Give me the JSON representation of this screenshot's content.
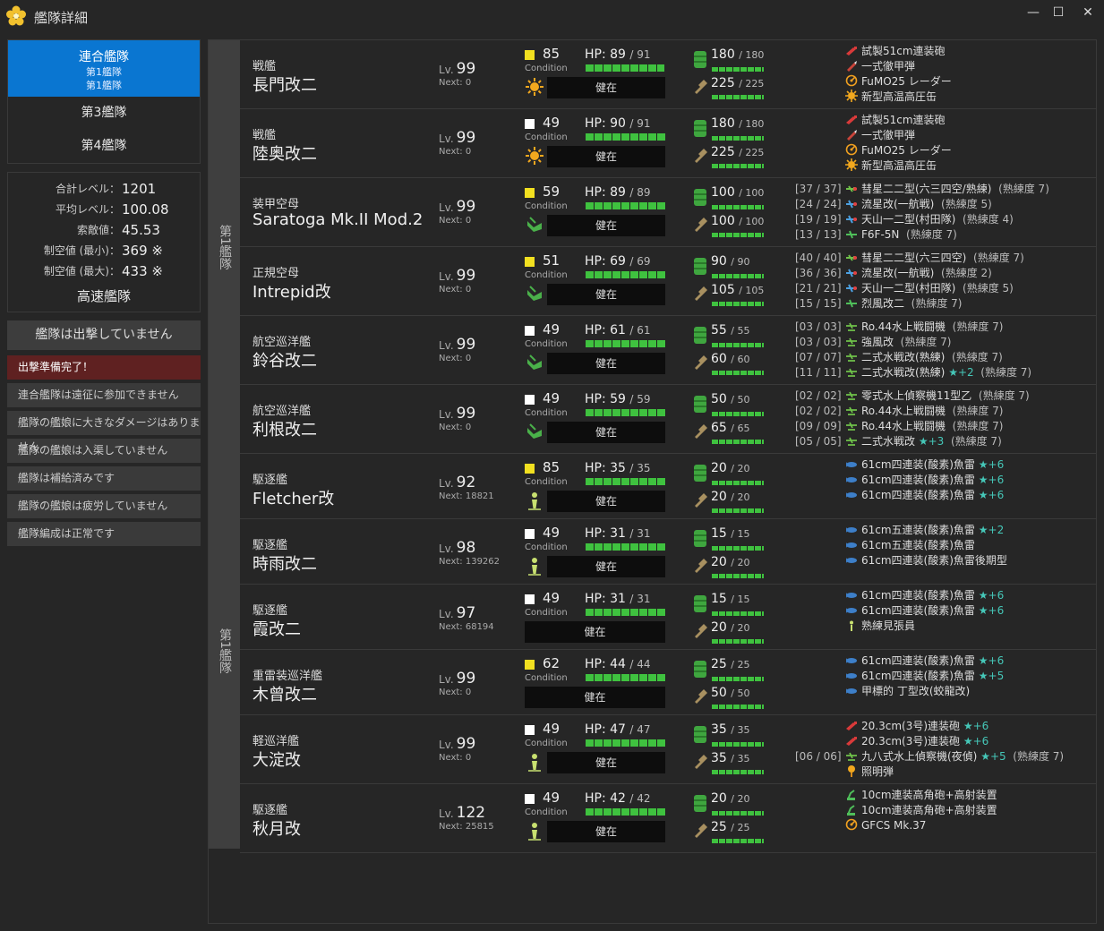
{
  "window": {
    "title": "艦隊詳細",
    "min": "—",
    "max": "☐",
    "close": "✕",
    "accent": "#0a76d1"
  },
  "sidebar": {
    "fleets": [
      {
        "label": "連合艦隊",
        "sub1": "第1艦隊",
        "sub2": "第1艦隊"
      },
      {
        "label": "第3艦隊"
      },
      {
        "label": "第4艦隊"
      }
    ],
    "stats": [
      {
        "label": "合計レベル：",
        "value": "1201"
      },
      {
        "label": "平均レベル：",
        "value": "100.08"
      },
      {
        "label": "索敵値：",
        "value": "45.53"
      },
      {
        "label": "制空値 (最小)：",
        "value": "369 ※"
      },
      {
        "label": "制空値 (最大)：",
        "value": "433 ※"
      }
    ],
    "speed": "高速艦隊",
    "sortie": "艦隊は出撃していません",
    "ready": "出撃準備完了！",
    "checks": [
      "連合艦隊は遠征に参加できません",
      "艦隊の艦娘に大きなダメージはありません",
      "艦隊の艦娘は入渠していません",
      "艦隊は補給済みです",
      "艦隊の艦娘は疲労していません",
      "艦隊編成は正常です"
    ]
  },
  "groups": [
    "第1艦隊",
    "第1艦隊"
  ],
  "ships": [
    {
      "type": "戦艦",
      "name": "長門改二",
      "lv": "99",
      "next": "Next: 0",
      "cond": "85",
      "condColor": "#f2e020",
      "condIcon": "sun",
      "hp": "89",
      "maxhp": "91",
      "hpFrac": 0.98,
      "status": "健在",
      "fuel": "180",
      "maxfuel": "180",
      "ammo": "225",
      "maxammo": "225",
      "eq": [
        {
          "slot": "",
          "name": "試製51cm連装砲",
          "icon": "gun-red"
        },
        {
          "slot": "",
          "name": "一式徹甲弾",
          "icon": "shell"
        },
        {
          "slot": "",
          "name": "FuMO25 レーダー",
          "icon": "radar"
        },
        {
          "slot": "",
          "name": "新型高温高圧缶",
          "icon": "boiler"
        }
      ]
    },
    {
      "type": "戦艦",
      "name": "陸奥改二",
      "lv": "99",
      "next": "Next: 0",
      "cond": "49",
      "condColor": "#ffffff",
      "condIcon": "sun",
      "hp": "90",
      "maxhp": "91",
      "hpFrac": 0.99,
      "status": "健在",
      "fuel": "180",
      "maxfuel": "180",
      "ammo": "225",
      "maxammo": "225",
      "eq": [
        {
          "slot": "",
          "name": "試製51cm連装砲",
          "icon": "gun-red"
        },
        {
          "slot": "",
          "name": "一式徹甲弾",
          "icon": "shell"
        },
        {
          "slot": "",
          "name": "FuMO25 レーダー",
          "icon": "radar"
        },
        {
          "slot": "",
          "name": "新型高温高圧缶",
          "icon": "boiler"
        }
      ]
    },
    {
      "type": "装甲空母",
      "name": "Saratoga Mk.II Mod.2",
      "lv": "99",
      "next": "Next: 0",
      "cond": "59",
      "condColor": "#f2e020",
      "condIcon": "carrier",
      "hp": "89",
      "maxhp": "89",
      "hpFrac": 1,
      "status": "健在",
      "fuel": "100",
      "maxfuel": "100",
      "ammo": "100",
      "maxammo": "100",
      "eq": [
        {
          "slot": "[37 / 37]",
          "name": "彗星二二型(六三四空/熟練)",
          "icon": "bomber",
          "prof": "(熟練度 7)"
        },
        {
          "slot": "[24 / 24]",
          "name": "流星改(一航戦)",
          "icon": "torp-plane",
          "prof": "(熟練度 5)"
        },
        {
          "slot": "[19 / 19]",
          "name": "天山一二型(村田隊)",
          "icon": "torp-plane",
          "prof": "(熟練度 4)"
        },
        {
          "slot": "[13 / 13]",
          "name": "F6F-5N",
          "icon": "fighter",
          "prof": "(熟練度 7)"
        }
      ]
    },
    {
      "type": "正規空母",
      "name": "Intrepid改",
      "lv": "99",
      "next": "Next: 0",
      "cond": "51",
      "condColor": "#f2e020",
      "condIcon": "carrier",
      "hp": "69",
      "maxhp": "69",
      "hpFrac": 1,
      "status": "健在",
      "fuel": "90",
      "maxfuel": "90",
      "ammo": "105",
      "maxammo": "105",
      "eq": [
        {
          "slot": "[40 / 40]",
          "name": "彗星二二型(六三四空)",
          "icon": "bomber",
          "prof": "(熟練度 7)"
        },
        {
          "slot": "[36 / 36]",
          "name": "流星改(一航戦)",
          "icon": "torp-plane",
          "prof": "(熟練度 2)"
        },
        {
          "slot": "[21 / 21]",
          "name": "天山一二型(村田隊)",
          "icon": "torp-plane",
          "prof": "(熟練度 5)"
        },
        {
          "slot": "[15 / 15]",
          "name": "烈風改二",
          "icon": "fighter",
          "prof": "(熟練度 7)"
        }
      ]
    },
    {
      "type": "航空巡洋艦",
      "name": "鈴谷改二",
      "lv": "99",
      "next": "Next: 0",
      "cond": "49",
      "condColor": "#ffffff",
      "condIcon": "carrier",
      "hp": "61",
      "maxhp": "61",
      "hpFrac": 1,
      "status": "健在",
      "fuel": "55",
      "maxfuel": "55",
      "ammo": "60",
      "maxammo": "60",
      "eq": [
        {
          "slot": "[03 / 03]",
          "name": "Ro.44水上戦闘機",
          "icon": "seaplane",
          "prof": "(熟練度 7)"
        },
        {
          "slot": "[03 / 03]",
          "name": "強風改",
          "icon": "seaplane",
          "prof": "(熟練度 7)"
        },
        {
          "slot": "[07 / 07]",
          "name": "二式水戦改(熟練)",
          "icon": "seaplane",
          "prof": "(熟練度 7)"
        },
        {
          "slot": "[11 / 11]",
          "name": "二式水戦改(熟練)",
          "icon": "seaplane",
          "star": "★+2",
          "prof": "(熟練度 7)"
        }
      ]
    },
    {
      "type": "航空巡洋艦",
      "name": "利根改二",
      "lv": "99",
      "next": "Next: 0",
      "cond": "49",
      "condColor": "#ffffff",
      "condIcon": "carrier",
      "hp": "59",
      "maxhp": "59",
      "hpFrac": 1,
      "status": "健在",
      "fuel": "50",
      "maxfuel": "50",
      "ammo": "65",
      "maxammo": "65",
      "eq": [
        {
          "slot": "[02 / 02]",
          "name": "零式水上偵察機11型乙",
          "icon": "seaplane",
          "prof": "(熟練度 7)"
        },
        {
          "slot": "[02 / 02]",
          "name": "Ro.44水上戦闘機",
          "icon": "seaplane",
          "prof": "(熟練度 7)"
        },
        {
          "slot": "[09 / 09]",
          "name": "Ro.44水上戦闘機",
          "icon": "seaplane",
          "prof": "(熟練度 7)"
        },
        {
          "slot": "[05 / 05]",
          "name": "二式水戦改",
          "icon": "seaplane",
          "star": "★+3",
          "prof": "(熟練度 7)"
        }
      ]
    },
    {
      "type": "駆逐艦",
      "name": "Fletcher改",
      "lv": "92",
      "next": "Next: 18821",
      "cond": "85",
      "condColor": "#f2e020",
      "condIcon": "person",
      "hp": "35",
      "maxhp": "35",
      "hpFrac": 1,
      "status": "健在",
      "fuel": "20",
      "maxfuel": "20",
      "ammo": "20",
      "maxammo": "20",
      "eq": [
        {
          "slot": "",
          "name": "61cm四連装(酸素)魚雷",
          "icon": "torpedo",
          "star": "★+6"
        },
        {
          "slot": "",
          "name": "61cm四連装(酸素)魚雷",
          "icon": "torpedo",
          "star": "★+6"
        },
        {
          "slot": "",
          "name": "61cm四連装(酸素)魚雷",
          "icon": "torpedo",
          "star": "★+6"
        }
      ]
    },
    {
      "type": "駆逐艦",
      "name": "時雨改二",
      "lv": "98",
      "next": "Next: 139262",
      "cond": "49",
      "condColor": "#ffffff",
      "condIcon": "person",
      "hp": "31",
      "maxhp": "31",
      "hpFrac": 1,
      "status": "健在",
      "fuel": "15",
      "maxfuel": "15",
      "ammo": "20",
      "maxammo": "20",
      "eq": [
        {
          "slot": "",
          "name": "61cm五連装(酸素)魚雷",
          "icon": "torpedo",
          "star": "★+2"
        },
        {
          "slot": "",
          "name": "61cm五連装(酸素)魚雷",
          "icon": "torpedo"
        },
        {
          "slot": "",
          "name": "61cm四連装(酸素)魚雷後期型",
          "icon": "torpedo"
        }
      ]
    },
    {
      "type": "駆逐艦",
      "name": "霞改二",
      "lv": "97",
      "next": "Next: 68194",
      "cond": "49",
      "condColor": "#ffffff",
      "condIcon": "",
      "hp": "31",
      "maxhp": "31",
      "hpFrac": 1,
      "status": "健在",
      "fuel": "15",
      "maxfuel": "15",
      "ammo": "20",
      "maxammo": "20",
      "eq": [
        {
          "slot": "",
          "name": "61cm四連装(酸素)魚雷",
          "icon": "torpedo",
          "star": "★+6"
        },
        {
          "slot": "",
          "name": "61cm四連装(酸素)魚雷",
          "icon": "torpedo",
          "star": "★+6"
        },
        {
          "slot": "",
          "name": "熟練見張員",
          "icon": "lookout"
        }
      ]
    },
    {
      "type": "重雷装巡洋艦",
      "name": "木曾改二",
      "lv": "99",
      "next": "Next: 0",
      "cond": "62",
      "condColor": "#f2e020",
      "condIcon": "",
      "hp": "44",
      "maxhp": "44",
      "hpFrac": 1,
      "status": "健在",
      "fuel": "25",
      "maxfuel": "25",
      "ammo": "50",
      "maxammo": "50",
      "eq": [
        {
          "slot": "",
          "name": "61cm四連装(酸素)魚雷",
          "icon": "torpedo",
          "star": "★+6"
        },
        {
          "slot": "",
          "name": "61cm四連装(酸素)魚雷",
          "icon": "torpedo",
          "star": "★+5"
        },
        {
          "slot": "",
          "name": "甲標的 丁型改(蛟龍改)",
          "icon": "torpedo"
        }
      ]
    },
    {
      "type": "軽巡洋艦",
      "name": "大淀改",
      "lv": "99",
      "next": "Next: 0",
      "cond": "49",
      "condColor": "#ffffff",
      "condIcon": "person",
      "hp": "47",
      "maxhp": "47",
      "hpFrac": 1,
      "status": "健在",
      "fuel": "35",
      "maxfuel": "35",
      "ammo": "35",
      "maxammo": "35",
      "eq": [
        {
          "slot": "",
          "name": "20.3cm(3号)連装砲",
          "icon": "gun-red",
          "star": "★+6"
        },
        {
          "slot": "",
          "name": "20.3cm(3号)連装砲",
          "icon": "gun-red",
          "star": "★+6"
        },
        {
          "slot": "[06 / 06]",
          "name": "九八式水上偵察機(夜偵)",
          "icon": "seaplane",
          "star": "★+5",
          "prof": "(熟練度 7)"
        },
        {
          "slot": "",
          "name": "照明弾",
          "icon": "flare"
        }
      ]
    },
    {
      "type": "駆逐艦",
      "name": "秋月改",
      "lv": "122",
      "next": "Next: 25815",
      "cond": "49",
      "condColor": "#ffffff",
      "condIcon": "person",
      "hp": "42",
      "maxhp": "42",
      "hpFrac": 1,
      "status": "健在",
      "fuel": "20",
      "maxfuel": "20",
      "ammo": "25",
      "maxammo": "25",
      "eq": [
        {
          "slot": "",
          "name": "10cm連装高角砲+高射装置",
          "icon": "aagun"
        },
        {
          "slot": "",
          "name": "10cm連装高角砲+高射装置",
          "icon": "aagun"
        },
        {
          "slot": "",
          "name": "GFCS Mk.37",
          "icon": "radar"
        }
      ]
    }
  ]
}
